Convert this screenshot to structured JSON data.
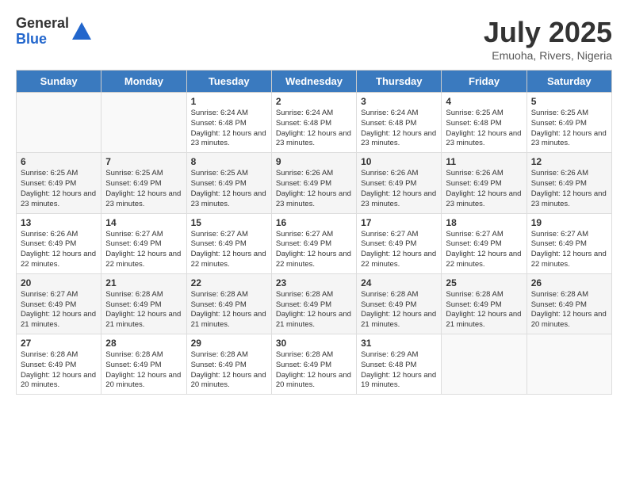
{
  "logo": {
    "general": "General",
    "blue": "Blue"
  },
  "title": "July 2025",
  "subtitle": "Emuoha, Rivers, Nigeria",
  "headers": [
    "Sunday",
    "Monday",
    "Tuesday",
    "Wednesday",
    "Thursday",
    "Friday",
    "Saturday"
  ],
  "weeks": [
    [
      {
        "day": "",
        "info": ""
      },
      {
        "day": "",
        "info": ""
      },
      {
        "day": "1",
        "info": "Sunrise: 6:24 AM\nSunset: 6:48 PM\nDaylight: 12 hours and 23 minutes."
      },
      {
        "day": "2",
        "info": "Sunrise: 6:24 AM\nSunset: 6:48 PM\nDaylight: 12 hours and 23 minutes."
      },
      {
        "day": "3",
        "info": "Sunrise: 6:24 AM\nSunset: 6:48 PM\nDaylight: 12 hours and 23 minutes."
      },
      {
        "day": "4",
        "info": "Sunrise: 6:25 AM\nSunset: 6:48 PM\nDaylight: 12 hours and 23 minutes."
      },
      {
        "day": "5",
        "info": "Sunrise: 6:25 AM\nSunset: 6:49 PM\nDaylight: 12 hours and 23 minutes."
      }
    ],
    [
      {
        "day": "6",
        "info": "Sunrise: 6:25 AM\nSunset: 6:49 PM\nDaylight: 12 hours and 23 minutes."
      },
      {
        "day": "7",
        "info": "Sunrise: 6:25 AM\nSunset: 6:49 PM\nDaylight: 12 hours and 23 minutes."
      },
      {
        "day": "8",
        "info": "Sunrise: 6:25 AM\nSunset: 6:49 PM\nDaylight: 12 hours and 23 minutes."
      },
      {
        "day": "9",
        "info": "Sunrise: 6:26 AM\nSunset: 6:49 PM\nDaylight: 12 hours and 23 minutes."
      },
      {
        "day": "10",
        "info": "Sunrise: 6:26 AM\nSunset: 6:49 PM\nDaylight: 12 hours and 23 minutes."
      },
      {
        "day": "11",
        "info": "Sunrise: 6:26 AM\nSunset: 6:49 PM\nDaylight: 12 hours and 23 minutes."
      },
      {
        "day": "12",
        "info": "Sunrise: 6:26 AM\nSunset: 6:49 PM\nDaylight: 12 hours and 23 minutes."
      }
    ],
    [
      {
        "day": "13",
        "info": "Sunrise: 6:26 AM\nSunset: 6:49 PM\nDaylight: 12 hours and 22 minutes."
      },
      {
        "day": "14",
        "info": "Sunrise: 6:27 AM\nSunset: 6:49 PM\nDaylight: 12 hours and 22 minutes."
      },
      {
        "day": "15",
        "info": "Sunrise: 6:27 AM\nSunset: 6:49 PM\nDaylight: 12 hours and 22 minutes."
      },
      {
        "day": "16",
        "info": "Sunrise: 6:27 AM\nSunset: 6:49 PM\nDaylight: 12 hours and 22 minutes."
      },
      {
        "day": "17",
        "info": "Sunrise: 6:27 AM\nSunset: 6:49 PM\nDaylight: 12 hours and 22 minutes."
      },
      {
        "day": "18",
        "info": "Sunrise: 6:27 AM\nSunset: 6:49 PM\nDaylight: 12 hours and 22 minutes."
      },
      {
        "day": "19",
        "info": "Sunrise: 6:27 AM\nSunset: 6:49 PM\nDaylight: 12 hours and 22 minutes."
      }
    ],
    [
      {
        "day": "20",
        "info": "Sunrise: 6:27 AM\nSunset: 6:49 PM\nDaylight: 12 hours and 21 minutes."
      },
      {
        "day": "21",
        "info": "Sunrise: 6:28 AM\nSunset: 6:49 PM\nDaylight: 12 hours and 21 minutes."
      },
      {
        "day": "22",
        "info": "Sunrise: 6:28 AM\nSunset: 6:49 PM\nDaylight: 12 hours and 21 minutes."
      },
      {
        "day": "23",
        "info": "Sunrise: 6:28 AM\nSunset: 6:49 PM\nDaylight: 12 hours and 21 minutes."
      },
      {
        "day": "24",
        "info": "Sunrise: 6:28 AM\nSunset: 6:49 PM\nDaylight: 12 hours and 21 minutes."
      },
      {
        "day": "25",
        "info": "Sunrise: 6:28 AM\nSunset: 6:49 PM\nDaylight: 12 hours and 21 minutes."
      },
      {
        "day": "26",
        "info": "Sunrise: 6:28 AM\nSunset: 6:49 PM\nDaylight: 12 hours and 20 minutes."
      }
    ],
    [
      {
        "day": "27",
        "info": "Sunrise: 6:28 AM\nSunset: 6:49 PM\nDaylight: 12 hours and 20 minutes."
      },
      {
        "day": "28",
        "info": "Sunrise: 6:28 AM\nSunset: 6:49 PM\nDaylight: 12 hours and 20 minutes."
      },
      {
        "day": "29",
        "info": "Sunrise: 6:28 AM\nSunset: 6:49 PM\nDaylight: 12 hours and 20 minutes."
      },
      {
        "day": "30",
        "info": "Sunrise: 6:28 AM\nSunset: 6:49 PM\nDaylight: 12 hours and 20 minutes."
      },
      {
        "day": "31",
        "info": "Sunrise: 6:29 AM\nSunset: 6:48 PM\nDaylight: 12 hours and 19 minutes."
      },
      {
        "day": "",
        "info": ""
      },
      {
        "day": "",
        "info": ""
      }
    ]
  ]
}
